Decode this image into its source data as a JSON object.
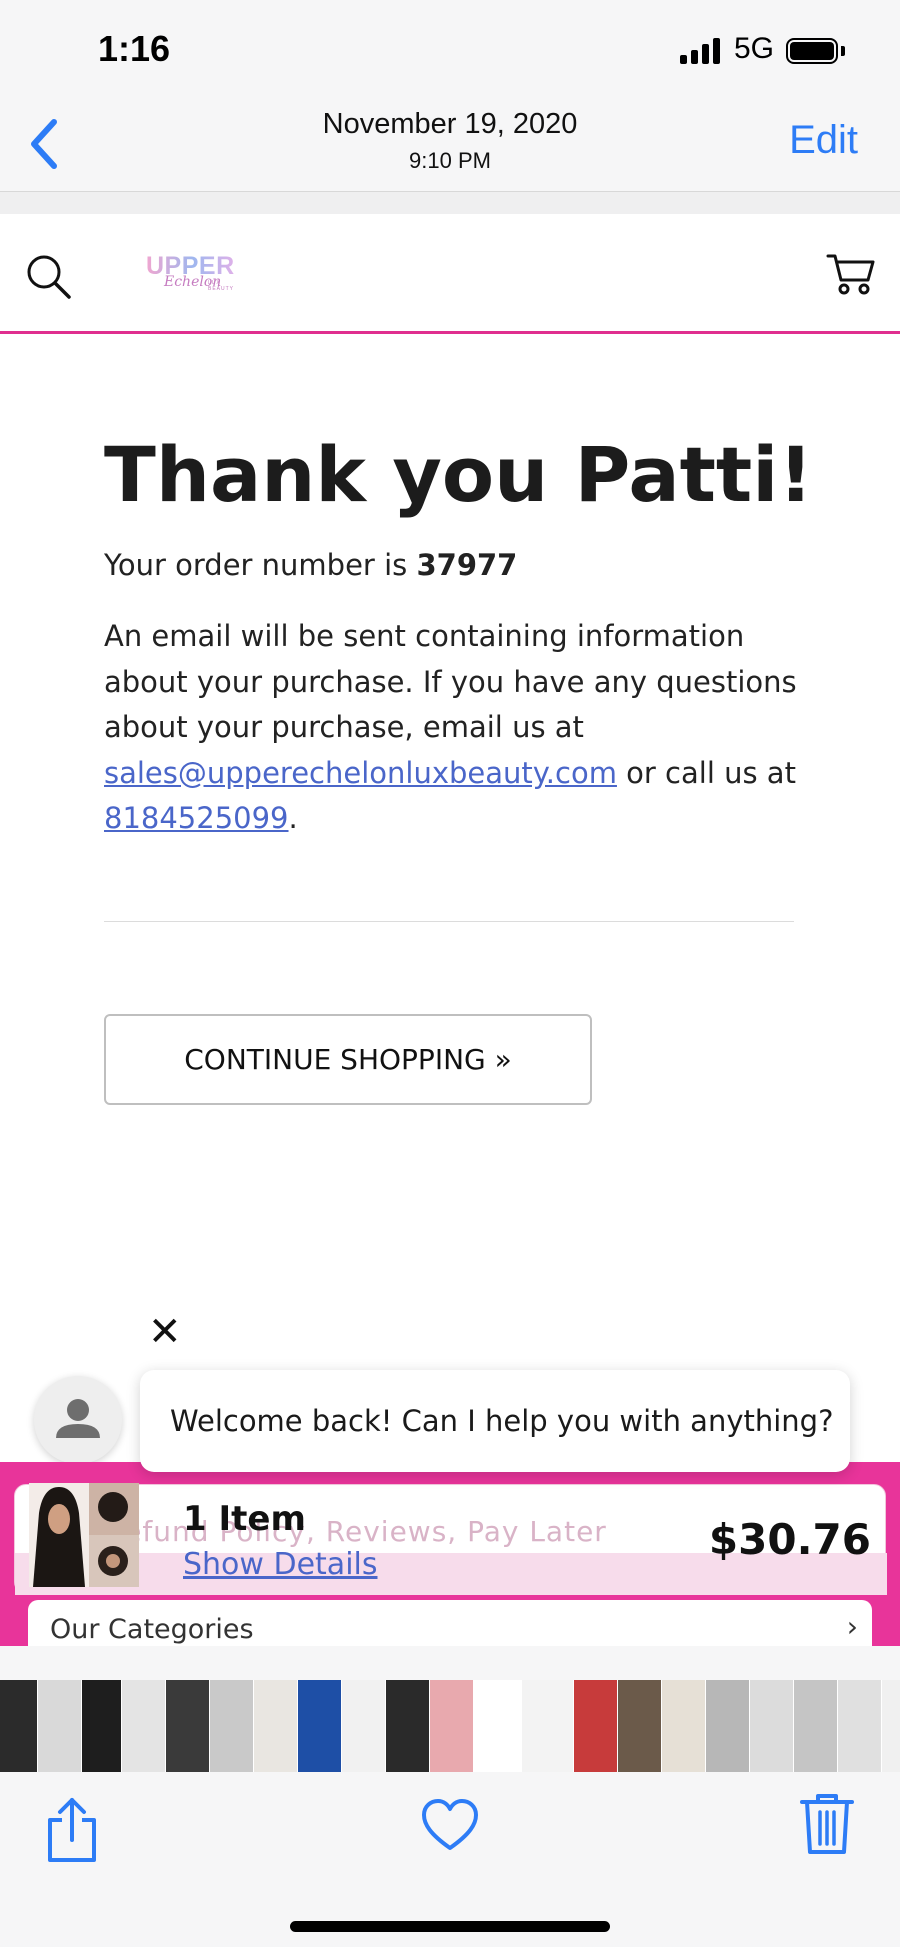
{
  "status_bar": {
    "time": "1:16",
    "network": "5G"
  },
  "photo_header": {
    "date": "November 19, 2020",
    "time": "9:10 PM",
    "edit_label": "Edit"
  },
  "site": {
    "logo_text": "UPPER",
    "logo_script": "Echelon",
    "logo_sub": "LUX BEAUTY"
  },
  "confirmation": {
    "title": "Thank you Patti!",
    "order_prefix": "Your order number is ",
    "order_number": "37977",
    "email_text": "An email will be sent containing information about your purchase. If you have any questions about your purchase, email us at",
    "email_link": "sales@upperechelonluxbeauty.com",
    "call_text": " or call us at ",
    "phone_link": "8184525099",
    "period": ".",
    "continue_label": "CONTINUE SHOPPING »"
  },
  "chat": {
    "close_glyph": "✕",
    "message": "Welcome back! Can I help you with anything?"
  },
  "cart_bar": {
    "ghost_text": "Refund Policy, Reviews, Pay Later",
    "item_count": "1 Item",
    "show_details": "Show Details",
    "total": "$30.76"
  },
  "categories": {
    "label": "Our Categories",
    "chevron": "›"
  },
  "thumbnail_strip": {
    "colors": [
      "#2b2b2b",
      "#d9d9d9",
      "#1e1e1e",
      "#e4e4e4",
      "#3a3a3a",
      "#c9c9c9",
      "#e9e6e1",
      "#1e4fa6",
      "#f1f1f1",
      "#2a2a2a",
      "#e8a9ae",
      "#ffffff",
      "#f3f3f3",
      "#c73b3b",
      "#6b5a4a",
      "#e6e0d6",
      "#b7b7b7",
      "#dcdcdc",
      "#c5c5c5",
      "#e0e0e0",
      "#f0f0f0",
      "#cfcfcf",
      "#ececec"
    ]
  },
  "toolbar": {
    "share_icon": "share-icon",
    "favorite_icon": "heart-icon",
    "delete_icon": "trash-icon"
  },
  "colors": {
    "accent_blue": "#2d7cf6",
    "brand_pink": "#e8349a",
    "link": "#4a66c9"
  }
}
